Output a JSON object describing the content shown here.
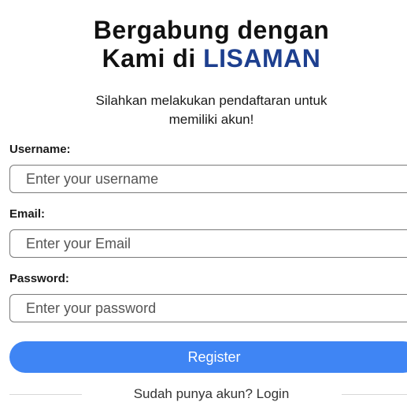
{
  "header": {
    "title_line1": "Bergabung dengan",
    "title_line2_prefix": "Kami di",
    "title_brand": "LISAMAN",
    "subtitle_line1": "Silahkan melakukan pendaftaran untuk",
    "subtitle_line2": "memiliki akun!"
  },
  "form": {
    "username_label": "Username:",
    "username_placeholder": "Enter your username",
    "email_label": "Email:",
    "email_placeholder": "Enter your Email",
    "password_label": "Password:",
    "password_placeholder": "Enter your password",
    "register_label": "Register"
  },
  "footer": {
    "login_prompt": "Sudah punya akun? Login"
  },
  "colors": {
    "brand": "#1d3f8f",
    "button": "#3f85f4"
  }
}
